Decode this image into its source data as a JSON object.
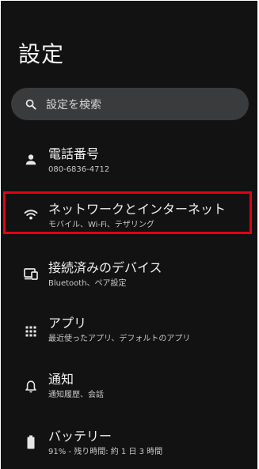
{
  "header": {
    "title": "設定"
  },
  "search": {
    "placeholder": "設定を検索",
    "icon": "search-icon"
  },
  "items": [
    {
      "id": "phone",
      "icon": "person-icon",
      "title": "電話番号",
      "subtitle": "080-6836-4712"
    },
    {
      "id": "network",
      "icon": "wifi-icon",
      "title": "ネットワークとインターネット",
      "subtitle": "モバイル、Wi-Fi、テザリング"
    },
    {
      "id": "devices",
      "icon": "connected-devices-icon",
      "title": "接続済みのデバイス",
      "subtitle": "Bluetooth、ペア設定"
    },
    {
      "id": "apps",
      "icon": "apps-grid-icon",
      "title": "アプリ",
      "subtitle": "最近使ったアプリ、デフォルトのアプリ"
    },
    {
      "id": "notifications",
      "icon": "bell-icon",
      "title": "通知",
      "subtitle": "通知履歴、会話"
    },
    {
      "id": "battery",
      "icon": "battery-icon",
      "title": "バッテリー",
      "subtitle": "91% - 残り時間: 約 1 日 3 時間"
    }
  ],
  "highlight": {
    "target": "network",
    "color": "#e60012"
  },
  "colors": {
    "background": "#121212",
    "search_background": "#3a3b3c",
    "text_primary": "#f0f0f0",
    "text_secondary": "#c8c8c8"
  }
}
